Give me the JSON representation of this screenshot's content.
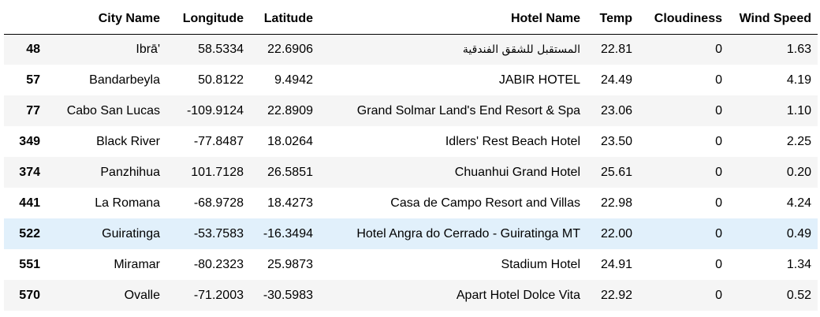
{
  "table": {
    "columns": [
      "",
      "City Name",
      "Longitude",
      "Latitude",
      "Hotel Name",
      "Temp",
      "Cloudiness",
      "Wind Speed"
    ],
    "rows": [
      {
        "index": "48",
        "city": "Ibrā'",
        "lng": "58.5334",
        "lat": "22.6906",
        "hotel": "المستقبل للشقق الفندقية",
        "temp": "22.81",
        "cloud": "0",
        "wind": "1.63"
      },
      {
        "index": "57",
        "city": "Bandarbeyla",
        "lng": "50.8122",
        "lat": "9.4942",
        "hotel": "JABIR HOTEL",
        "temp": "24.49",
        "cloud": "0",
        "wind": "4.19"
      },
      {
        "index": "77",
        "city": "Cabo San Lucas",
        "lng": "-109.9124",
        "lat": "22.8909",
        "hotel": "Grand Solmar Land's End Resort & Spa",
        "temp": "23.06",
        "cloud": "0",
        "wind": "1.10"
      },
      {
        "index": "349",
        "city": "Black River",
        "lng": "-77.8487",
        "lat": "18.0264",
        "hotel": "Idlers' Rest Beach Hotel",
        "temp": "23.50",
        "cloud": "0",
        "wind": "2.25"
      },
      {
        "index": "374",
        "city": "Panzhihua",
        "lng": "101.7128",
        "lat": "26.5851",
        "hotel": "Chuanhui Grand Hotel",
        "temp": "25.61",
        "cloud": "0",
        "wind": "0.20"
      },
      {
        "index": "441",
        "city": "La Romana",
        "lng": "-68.9728",
        "lat": "18.4273",
        "hotel": "Casa de Campo Resort and Villas",
        "temp": "22.98",
        "cloud": "0",
        "wind": "4.24"
      },
      {
        "index": "522",
        "city": "Guiratinga",
        "lng": "-53.7583",
        "lat": "-16.3494",
        "hotel": "Hotel Angra do Cerrado - Guiratinga MT",
        "temp": "22.00",
        "cloud": "0",
        "wind": "0.49"
      },
      {
        "index": "551",
        "city": "Miramar",
        "lng": "-80.2323",
        "lat": "25.9873",
        "hotel": "Stadium Hotel",
        "temp": "24.91",
        "cloud": "0",
        "wind": "1.34"
      },
      {
        "index": "570",
        "city": "Ovalle",
        "lng": "-71.2003",
        "lat": "-30.5983",
        "hotel": "Apart Hotel Dolce Vita",
        "temp": "22.92",
        "cloud": "0",
        "wind": "0.52"
      }
    ],
    "hovered_row": "522"
  },
  "colors": {
    "header_border": "#000000",
    "row_stripe": "#f5f5f5",
    "row_hover": "#e1f0fb"
  }
}
